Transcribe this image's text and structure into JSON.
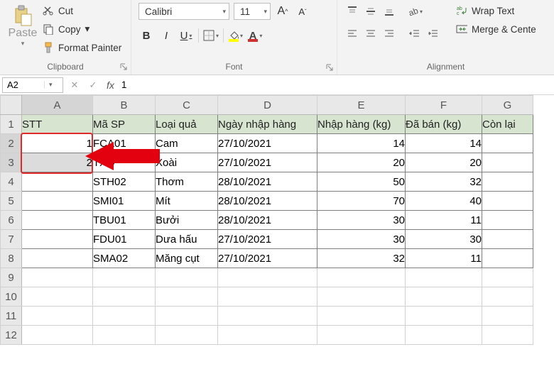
{
  "ribbon": {
    "clipboard": {
      "paste": "Paste",
      "cut": "Cut",
      "copy": "Copy",
      "format_painter": "Format Painter",
      "label": "Clipboard"
    },
    "font": {
      "name": "Calibri",
      "size": "11",
      "bold": "B",
      "italic": "I",
      "underline": "U",
      "label": "Font",
      "grow": "A",
      "shrink": "A"
    },
    "alignment": {
      "wrap": "Wrap Text",
      "merge": "Merge & Cente",
      "label": "Alignment"
    }
  },
  "namebox": "A2",
  "fx_cancel": "✕",
  "fx_enter": "✓",
  "fx_label": "fx",
  "formula": "1",
  "columns": [
    "A",
    "B",
    "C",
    "D",
    "E",
    "F",
    "G"
  ],
  "rows": [
    "1",
    "2",
    "3",
    "4",
    "5",
    "6",
    "7",
    "8",
    "9",
    "10",
    "11",
    "12"
  ],
  "headers": {
    "A": "STT",
    "B": "Mã SP",
    "C": "Loại quả",
    "D": "Ngày nhập hàng",
    "E": "Nhập hàng (kg)",
    "F": "Đã bán (kg)",
    "G": "Còn lại"
  },
  "data": [
    {
      "A": "1",
      "B": "FCA01",
      "C": "Cam",
      "D": "27/10/2021",
      "E": "14",
      "F": "14"
    },
    {
      "A": "2",
      "B": "TXO",
      "C": "Xoài",
      "D": "27/10/2021",
      "E": "20",
      "F": "20"
    },
    {
      "A": "",
      "B": "STH02",
      "C": "Thơm",
      "D": "28/10/2021",
      "E": "50",
      "F": "32"
    },
    {
      "A": "",
      "B": "SMI01",
      "C": "Mít",
      "D": "28/10/2021",
      "E": "70",
      "F": "40"
    },
    {
      "A": "",
      "B": "TBU01",
      "C": "Bưởi",
      "D": "28/10/2021",
      "E": "30",
      "F": "11"
    },
    {
      "A": "",
      "B": "FDU01",
      "C": "Dưa hấu",
      "D": "27/10/2021",
      "E": "30",
      "F": "30"
    },
    {
      "A": "",
      "B": "SMA02",
      "C": "Măng cụt",
      "D": "27/10/2021",
      "E": "32",
      "F": "11"
    }
  ]
}
